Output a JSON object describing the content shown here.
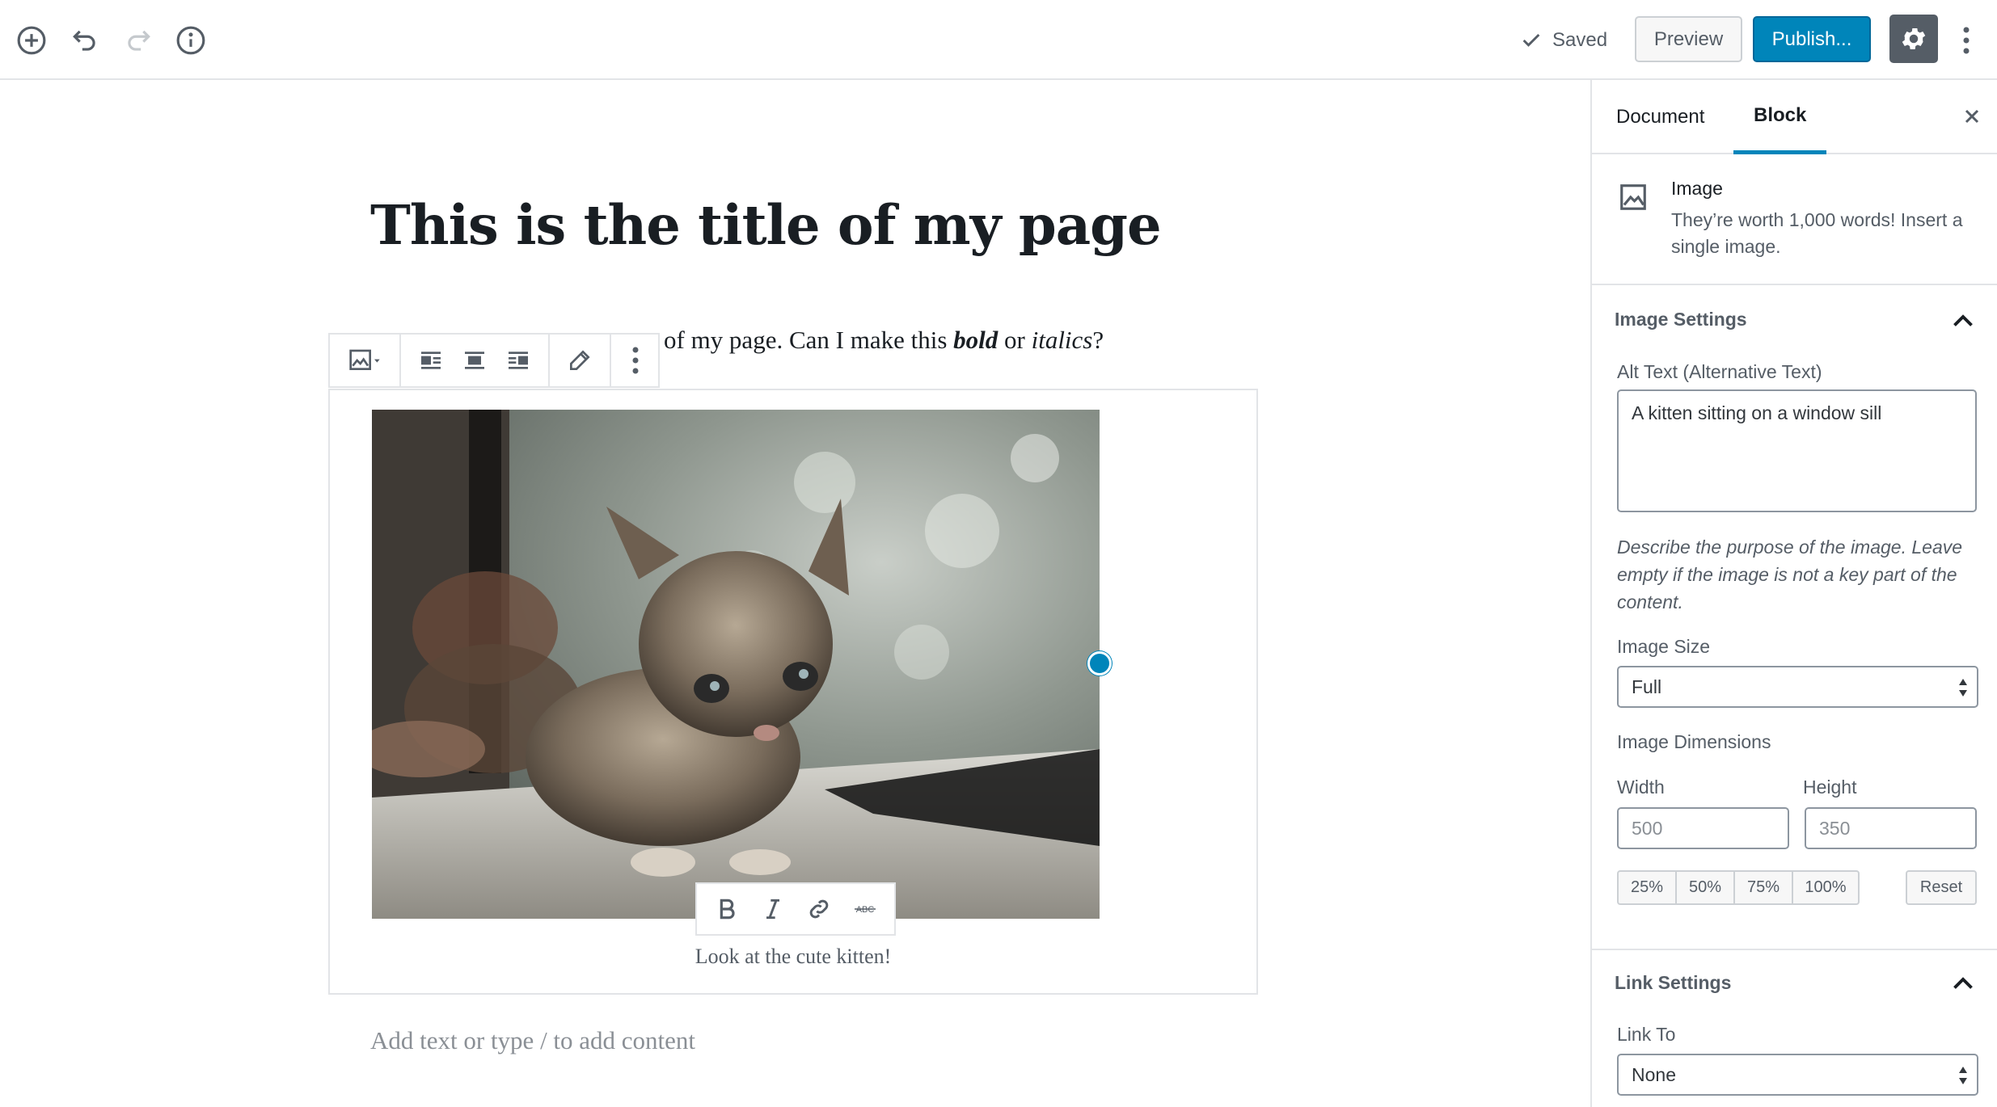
{
  "colors": {
    "accent": "#0085ba",
    "text": "#191e23",
    "muted": "#555d66",
    "border": "#e2e4e7"
  },
  "toolbar": {
    "icons": [
      "add-block-icon",
      "undo-icon",
      "redo-icon",
      "info-icon"
    ],
    "saved_label": "Saved",
    "preview_label": "Preview",
    "publish_label": "Publish..."
  },
  "editor": {
    "title": "This is the title of my page",
    "paragraph": {
      "before": "of my page. Can I make this ",
      "bold_italic": "bold",
      "middle": " or ",
      "italic": "italics",
      "after": "?"
    },
    "block_toolbar_icons": [
      "image-icon",
      "align-left-icon",
      "align-center-icon",
      "align-right-icon",
      "edit-pencil-icon",
      "more-vertical-icon"
    ],
    "format_toolbar_icons": [
      "bold-icon",
      "italic-icon",
      "link-icon",
      "strikethrough-icon"
    ],
    "image_alt": "A kitten sitting on a window sill",
    "caption": "Look at the cute kitten!",
    "appender_placeholder": "Add text or type / to add content"
  },
  "sidebar": {
    "tabs": [
      {
        "label": "Document"
      },
      {
        "label": "Block"
      }
    ],
    "block_card": {
      "title": "Image",
      "description": "They’re worth 1,000 words! Insert a single image."
    },
    "image_settings": {
      "title": "Image Settings",
      "alt_label": "Alt Text (Alternative Text)",
      "alt_value": "A kitten sitting on a window sill",
      "help": "Describe the purpose of the image. Leave empty if the image is not a key part of the content.",
      "size_label": "Image Size",
      "size_value": "Full",
      "dimensions_label": "Image Dimensions",
      "width_label": "Width",
      "width_placeholder": "500",
      "height_label": "Height",
      "height_placeholder": "350",
      "percent_buttons": [
        "25%",
        "50%",
        "75%",
        "100%"
      ],
      "reset_label": "Reset"
    },
    "link_settings": {
      "title": "Link Settings",
      "link_to_label": "Link To",
      "link_to_value": "None"
    }
  }
}
